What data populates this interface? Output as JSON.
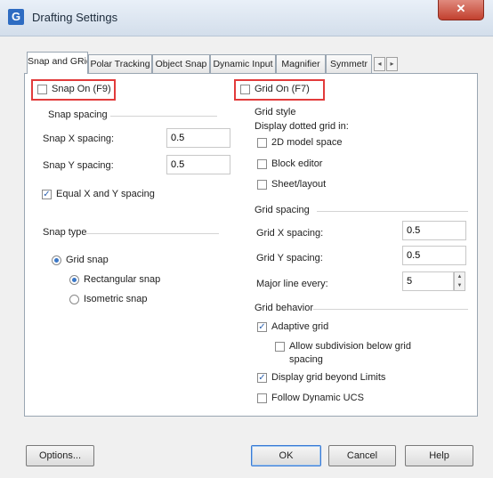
{
  "window": {
    "title": "Drafting Settings",
    "app_icon_letter": "G",
    "close_glyph": "✕"
  },
  "tabs": [
    "Snap and GRid",
    "Polar Tracking",
    "Object Snap",
    "Dynamic Input",
    "Magnifier",
    "Symmetr"
  ],
  "tab_scroll": {
    "left": "◂",
    "right": "▸"
  },
  "left": {
    "snap_on": {
      "label": "Snap On (F9)",
      "checked": false
    },
    "snap_spacing_header": "Snap spacing",
    "snap_x": {
      "label": "Snap X spacing:",
      "value": "0.5"
    },
    "snap_y": {
      "label": "Snap Y spacing:",
      "value": "0.5"
    },
    "equal_xy": {
      "label": "Equal X and Y spacing",
      "checked": true
    },
    "snap_type_header": "Snap type",
    "grid_snap": "Grid snap",
    "rectangular_snap": "Rectangular snap",
    "isometric_snap": "Isometric snap"
  },
  "right": {
    "grid_on": {
      "label": "Grid On (F7)",
      "checked": false
    },
    "grid_style_header": "Grid style",
    "display_dotted": "Display dotted grid in:",
    "model_space": "2D model space",
    "block_editor": "Block editor",
    "sheet_layout": "Sheet/layout",
    "grid_spacing_header": "Grid spacing",
    "grid_x": {
      "label": "Grid X spacing:",
      "value": "0.5"
    },
    "grid_y": {
      "label": "Grid Y spacing:",
      "value": "0.5"
    },
    "major_line": {
      "label": "Major line every:",
      "value": "5"
    },
    "grid_behavior_header": "Grid behavior",
    "adaptive_grid": {
      "label": "Adaptive grid",
      "checked": true
    },
    "allow_subdivision": {
      "label_line1": "Allow subdivision below grid",
      "label_line2": "spacing",
      "checked": false
    },
    "display_beyond": {
      "label": "Display grid beyond Limits",
      "checked": true
    },
    "follow_ucs": {
      "label": "Follow Dynamic UCS",
      "checked": false
    }
  },
  "check_glyph": "✓",
  "buttons": {
    "options": "Options...",
    "ok": "OK",
    "cancel": "Cancel",
    "help": "Help"
  }
}
